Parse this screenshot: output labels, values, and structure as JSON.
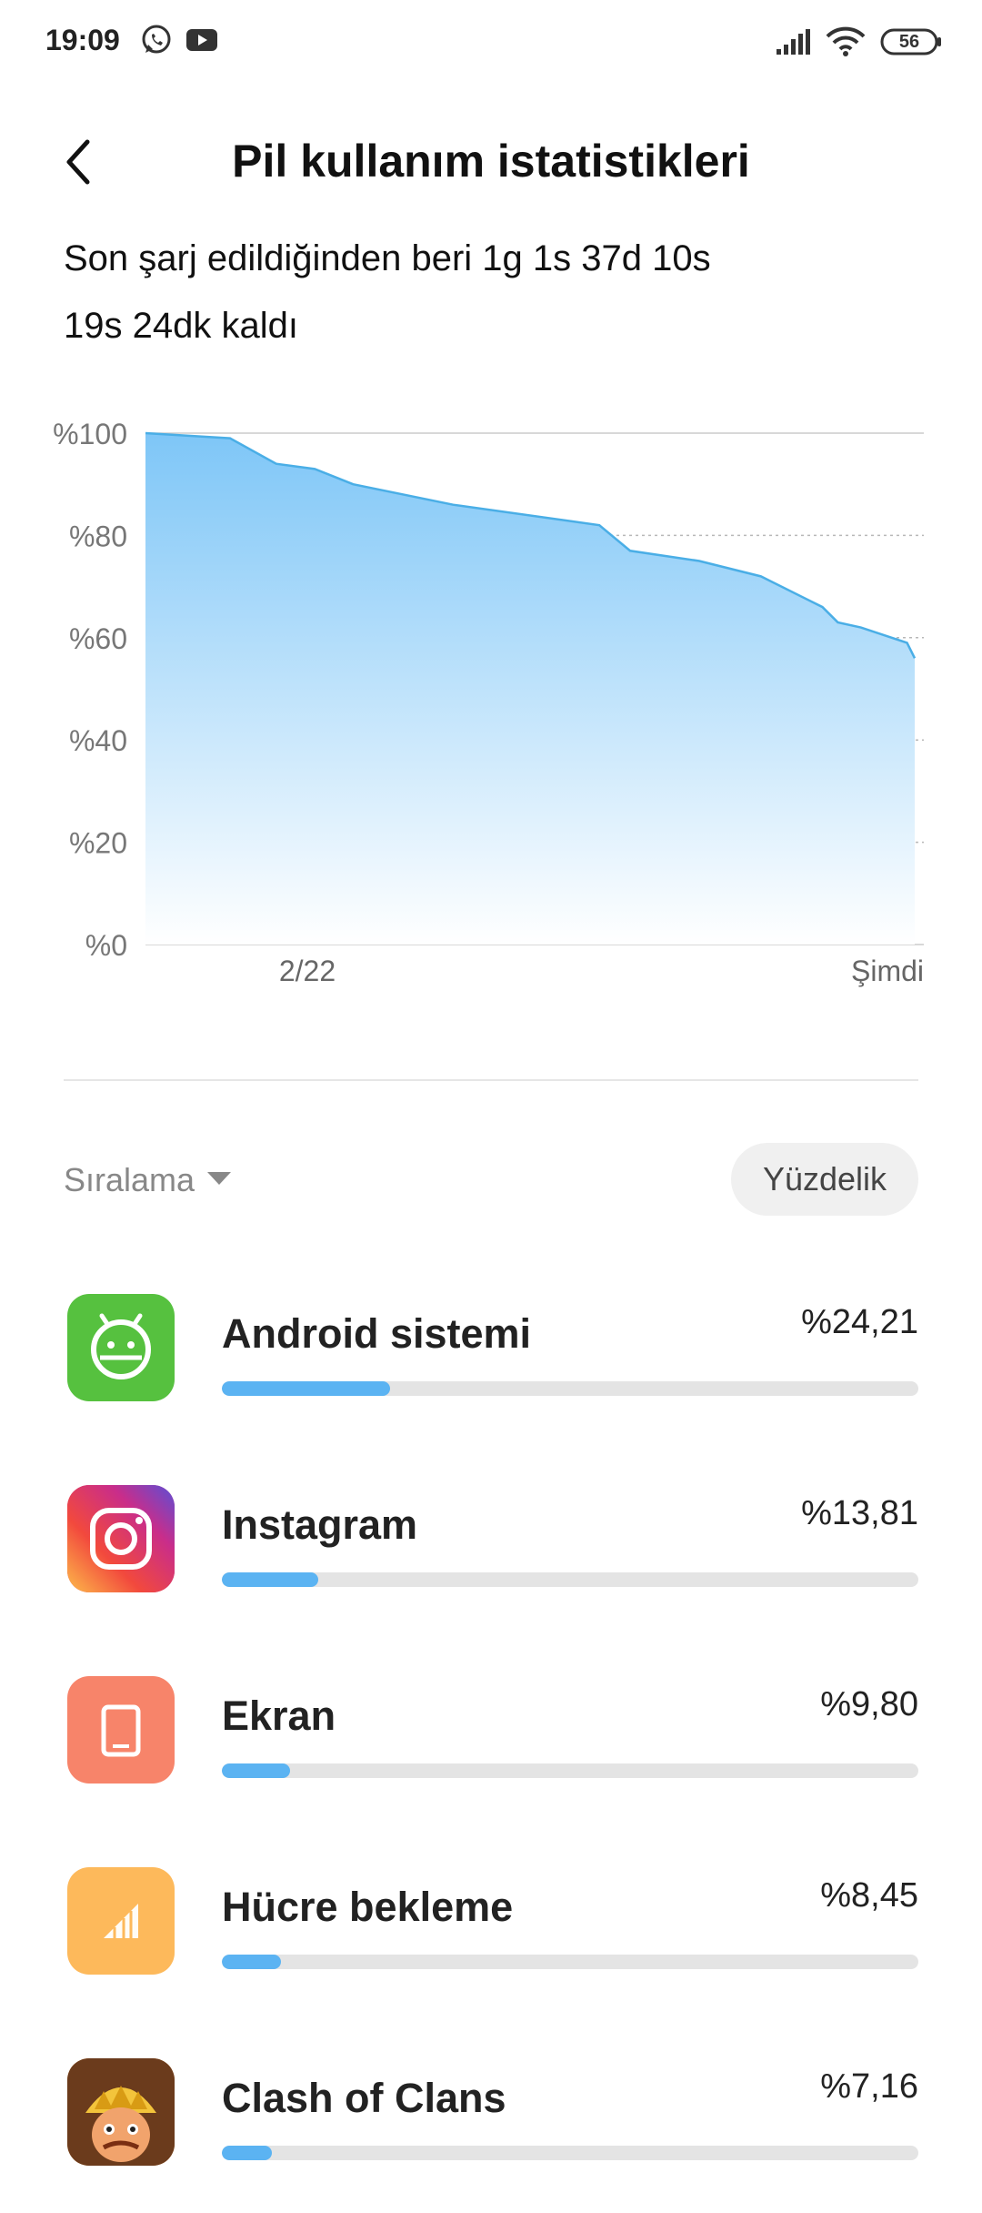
{
  "status_bar": {
    "time": "19:09",
    "battery_level": "56",
    "icons": [
      "whatsapp-icon",
      "youtube-icon",
      "signal-icon",
      "wifi-icon",
      "battery-icon"
    ]
  },
  "header": {
    "title": "Pil kullanım istatistikleri",
    "back_icon": "chevron-left-icon"
  },
  "summary": {
    "since_charge": "Son şarj edildiğinden beri 1g 1s 37d 10s",
    "remaining": "19s 24dk kaldı"
  },
  "chart_data": {
    "type": "area",
    "y_tick_labels": [
      "%100",
      "%80",
      "%60",
      "%40",
      "%20",
      "%0"
    ],
    "y_ticks": [
      100,
      80,
      60,
      40,
      20,
      0
    ],
    "ylim": [
      0,
      100
    ],
    "x_tick_labels": [
      "2/22",
      "Şimdi"
    ],
    "grid": true,
    "x": [
      0,
      0.11,
      0.17,
      0.22,
      0.27,
      0.4,
      0.59,
      0.63,
      0.72,
      0.8,
      0.88,
      0.9,
      0.93,
      0.99,
      1.0
    ],
    "values": [
      100,
      99,
      94,
      93,
      90,
      86,
      82,
      77,
      75,
      72,
      66,
      63,
      62,
      59,
      56
    ],
    "colors": {
      "line": "#4aaee6",
      "fill_top": "#7ec6f7",
      "fill_bottom": "#ffffff",
      "grid": "#b8b8b8",
      "axis": "#cccccc"
    }
  },
  "controls": {
    "sort_label": "Sıralama",
    "mode_label": "Yüzdelik"
  },
  "apps": [
    {
      "name": "Android sistemi",
      "percent_label": "%24,21",
      "percent": 24.21,
      "icon": "android-icon",
      "icon_color": "#56c13f"
    },
    {
      "name": "Instagram",
      "percent_label": "%13,81",
      "percent": 13.81,
      "icon": "instagram-icon",
      "icon_color": "#d6317a"
    },
    {
      "name": "Ekran",
      "percent_label": "%9,80",
      "percent": 9.8,
      "icon": "screen-icon",
      "icon_color": "#f7846a"
    },
    {
      "name": "Hücre bekleme",
      "percent_label": "%8,45",
      "percent": 8.45,
      "icon": "cell-signal-icon",
      "icon_color": "#fdb95b"
    },
    {
      "name": "Clash of Clans",
      "percent_label": "%7,16",
      "percent": 7.16,
      "icon": "clash-of-clans-icon",
      "icon_color": "#e58a2c"
    }
  ],
  "bar_scale_max": 100
}
